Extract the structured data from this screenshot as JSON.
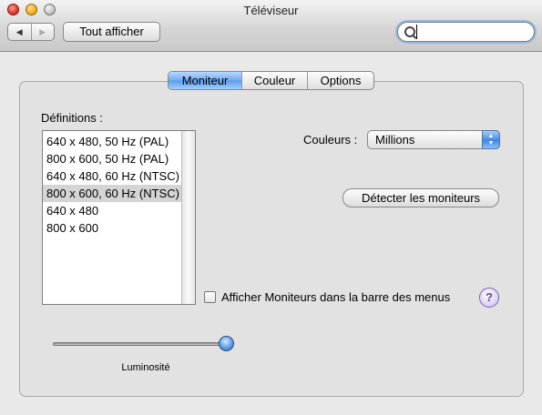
{
  "window": {
    "title": "Téléviseur"
  },
  "toolbar": {
    "back_icon": "left-arrow",
    "forward_icon": "right-arrow",
    "show_all": "Tout afficher",
    "search_placeholder": ""
  },
  "tabs": [
    {
      "label": "Moniteur",
      "selected": true
    },
    {
      "label": "Couleur",
      "selected": false
    },
    {
      "label": "Options",
      "selected": false
    }
  ],
  "resolutions": {
    "label": "Définitions :",
    "items": [
      "640 x 480, 50 Hz (PAL)",
      "800 x 600, 50 Hz (PAL)",
      "640 x 480, 60 Hz (NTSC)",
      "800 x 600, 60 Hz (NTSC)",
      "640 x 480",
      "800 x 600"
    ],
    "selected_index": 3
  },
  "colors": {
    "label": "Couleurs :",
    "value": "Millions"
  },
  "detect_button": "Détecter les moniteurs",
  "menu_bar_option": {
    "label": "Afficher Moniteurs dans la barre des menus",
    "checked": false
  },
  "help": {
    "label": "?"
  },
  "brightness": {
    "label": "Luminosité",
    "value": 1.0
  },
  "colors_accent": {
    "selection": "#5b9ce8",
    "window": "#e9e9e9"
  }
}
